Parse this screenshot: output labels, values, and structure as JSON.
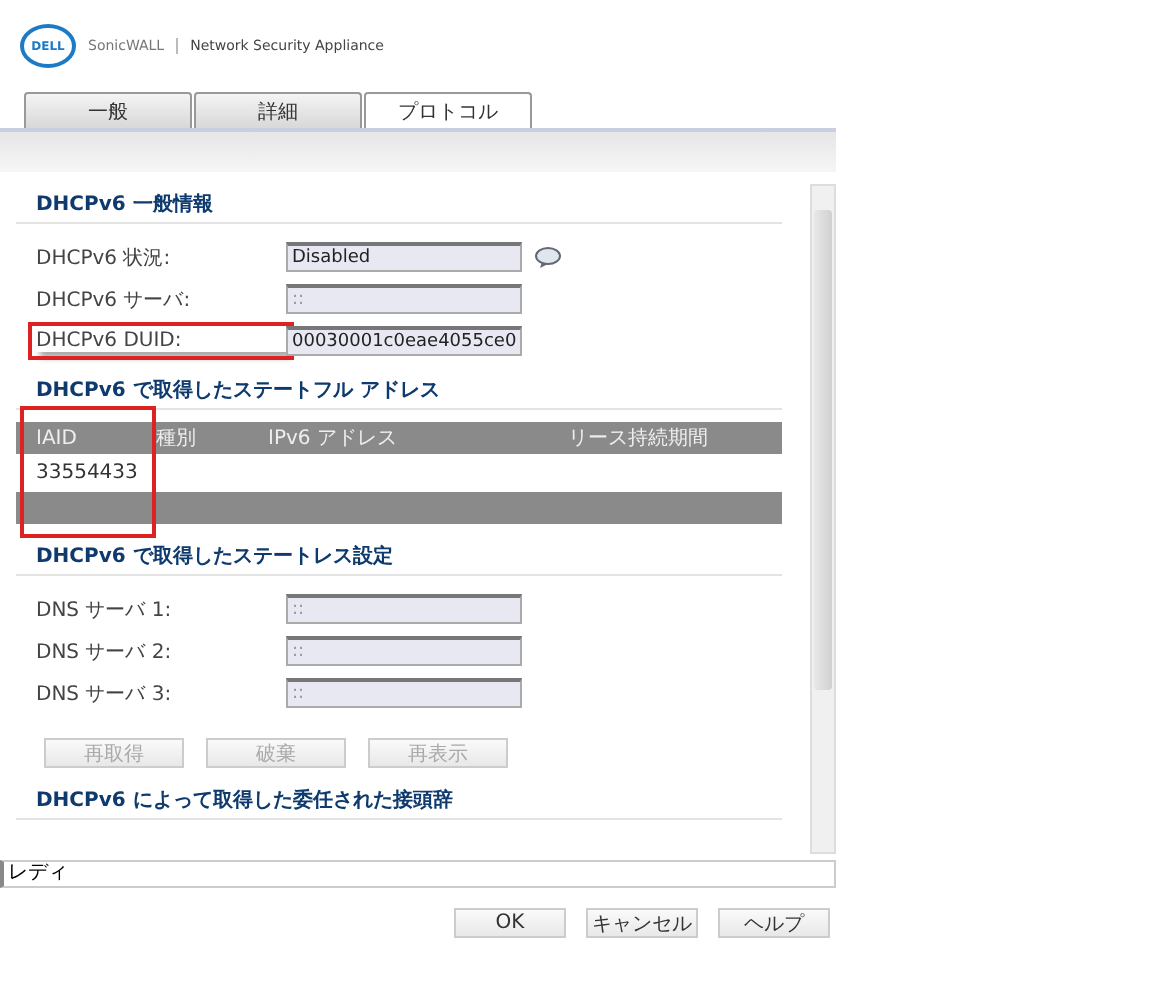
{
  "header": {
    "logo": "DELL",
    "product": "SonicWALL",
    "subtitle": "Network Security Appliance"
  },
  "tabs": [
    {
      "label": "一般",
      "selected": false
    },
    {
      "label": "詳細",
      "selected": false
    },
    {
      "label": "プロトコル",
      "selected": true
    }
  ],
  "general": {
    "title": "DHCPv6 一般情報",
    "fields": [
      {
        "label": "DHCPv6 状況:",
        "value": "Disabled",
        "disabled": false,
        "highlighted": false,
        "comment_icon": true
      },
      {
        "label": "DHCPv6 サーバ:",
        "value": "::",
        "disabled": true,
        "highlighted": false,
        "comment_icon": false
      },
      {
        "label": "DHCPv6 DUID:",
        "value": "00030001c0eae4055ce0",
        "disabled": false,
        "highlighted": true,
        "comment_icon": false
      }
    ]
  },
  "stateful": {
    "title": "DHCPv6 で取得したステートフル アドレス",
    "table": {
      "columns": [
        {
          "label": "IAID",
          "highlighted": true
        },
        {
          "label": "種別",
          "highlighted": false
        },
        {
          "label": "IPv6 アドレス",
          "highlighted": false
        },
        {
          "label": "リース持続期間",
          "highlighted": false
        }
      ],
      "rows": [
        [
          "33554433"
        ]
      ]
    }
  },
  "stateless": {
    "title": "DHCPv6 で取得したステートレス設定",
    "fields": [
      {
        "label": "DNS サーバ 1:",
        "value": "::",
        "disabled": true
      },
      {
        "label": "DNS サーバ 2:",
        "value": "::",
        "disabled": true
      },
      {
        "label": "DNS サーバ 3:",
        "value": "::",
        "disabled": true
      }
    ],
    "buttons": [
      {
        "label": "再取得",
        "disabled": true
      },
      {
        "label": "破棄",
        "disabled": true
      },
      {
        "label": "再表示",
        "disabled": true
      }
    ]
  },
  "delegated": {
    "title": "DHCPv6 によって取得した委任された接頭辞"
  },
  "status_bar": "レディ",
  "buttons": [
    {
      "label": "OK"
    },
    {
      "label": "キャンセル"
    },
    {
      "label": "ヘルプ"
    }
  ]
}
